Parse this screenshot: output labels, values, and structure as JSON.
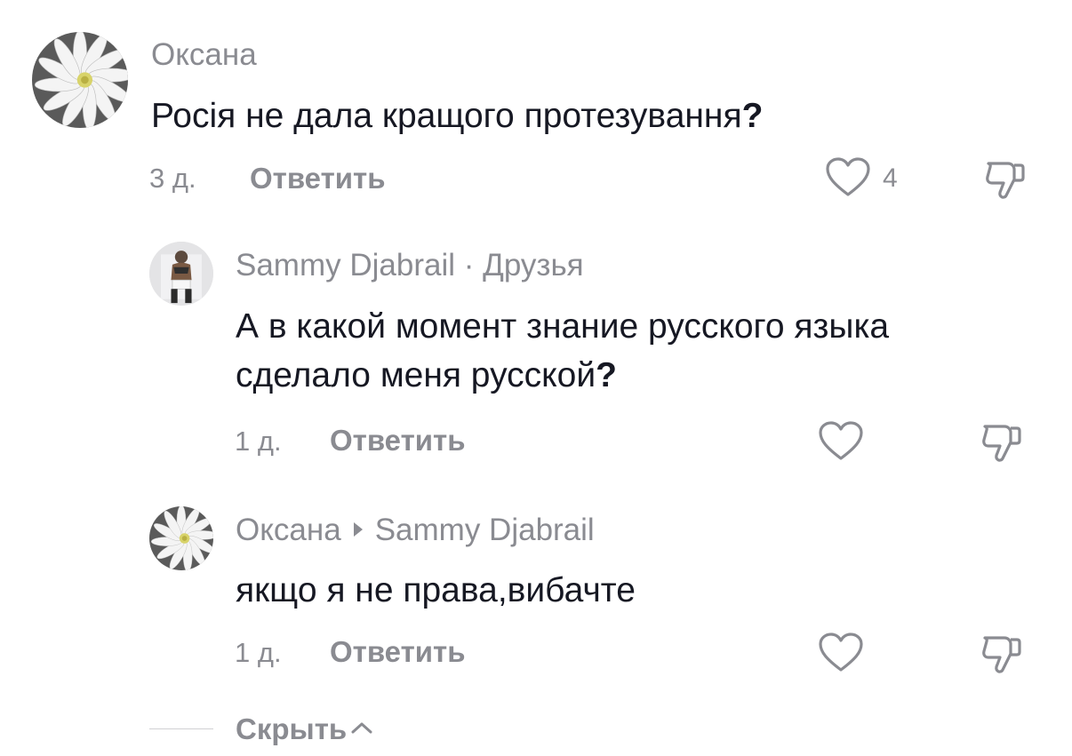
{
  "comments": [
    {
      "author": "Оксана",
      "text": "Росія не дала кращого протезування",
      "text_mark": "?",
      "time": "3 д.",
      "reply_label": "Ответить",
      "likes": "4",
      "avatar_icon": "daisy-avatar"
    },
    {
      "author": "Sammy Djabrail",
      "separator": "·",
      "relation": "Друзья",
      "text_line1": "А в какой момент знание русского языка",
      "text_line2": "сделало меня русской",
      "text_mark": "?",
      "time": "1 д.",
      "reply_label": "Ответить",
      "avatar_icon": "person-avatar"
    },
    {
      "author": "Оксана",
      "reply_to": "Sammy Djabrail",
      "text": "якщо я не права,вибачте",
      "time": "1 д.",
      "reply_label": "Ответить",
      "avatar_icon": "daisy-avatar"
    }
  ],
  "footer": {
    "hide_label": "Скрыть"
  },
  "colors": {
    "muted": "#8a8b91",
    "text": "#161823",
    "divider": "#d0d0d3"
  }
}
